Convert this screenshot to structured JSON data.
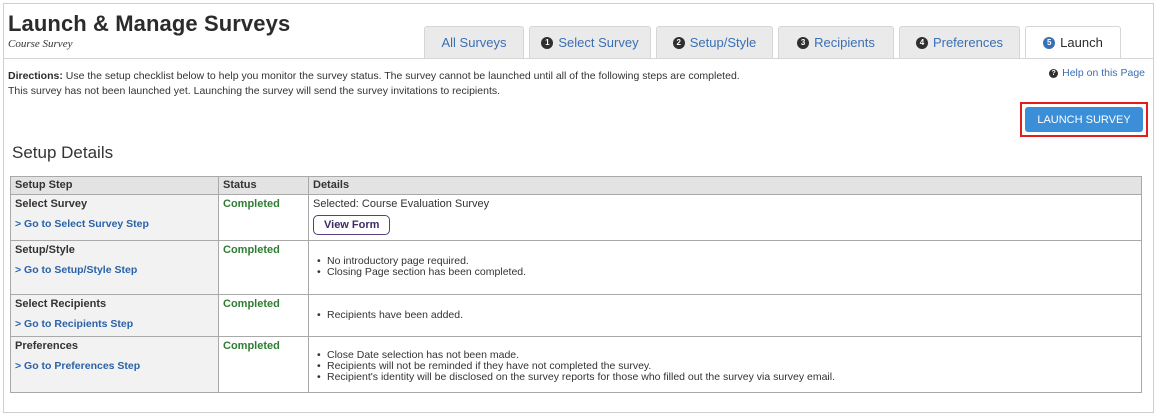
{
  "header": {
    "title": "Launch & Manage Surveys",
    "subtitle": "Course Survey"
  },
  "tabs": [
    {
      "num": "",
      "label": "All Surveys",
      "active": false
    },
    {
      "num": "1",
      "label": "Select Survey",
      "active": false
    },
    {
      "num": "2",
      "label": "Setup/Style",
      "active": false
    },
    {
      "num": "3",
      "label": "Recipients",
      "active": false
    },
    {
      "num": "4",
      "label": "Preferences",
      "active": false
    },
    {
      "num": "5",
      "label": "Launch",
      "active": true
    }
  ],
  "directions": {
    "prefix": "Directions:",
    "line1": "Use the setup checklist below to help you monitor the survey status. The survey cannot be launched until all of the following steps are completed.",
    "line2": "This survey has not been launched yet. Launching the survey will send the survey invitations to recipients."
  },
  "help": {
    "icon": "question-icon",
    "label": "Help on this Page"
  },
  "launch_button": "LAUNCH SURVEY",
  "section_title": "Setup Details",
  "table": {
    "headers": [
      "Setup Step",
      "Status",
      "Details"
    ],
    "rows": [
      {
        "step": "Select Survey",
        "link": "> Go to Select Survey Step",
        "status": "Completed",
        "selected_text": "Selected: Course Evaluation Survey",
        "button": "View Form",
        "bullets": []
      },
      {
        "step": "Setup/Style",
        "link": "> Go to Setup/Style Step",
        "status": "Completed",
        "bullets": [
          "No introductory page required.",
          "Closing Page section has been completed."
        ]
      },
      {
        "step": "Select Recipients",
        "link": "> Go to Recipients Step",
        "status": "Completed",
        "bullets": [
          "Recipients have been added."
        ]
      },
      {
        "step": "Preferences",
        "link": "> Go to Preferences Step",
        "status": "Completed",
        "bullets": [
          "Close Date selection has not been made.",
          "Recipients will not be reminded if they have not completed the survey.",
          "Recipient's identity will be disclosed on the survey reports for those who filled out the survey via survey email."
        ]
      }
    ]
  },
  "colors": {
    "accent": "#3a6fb4",
    "button": "#3b8fd8",
    "highlight": "#e11d1d",
    "completed": "#2e7d32"
  }
}
